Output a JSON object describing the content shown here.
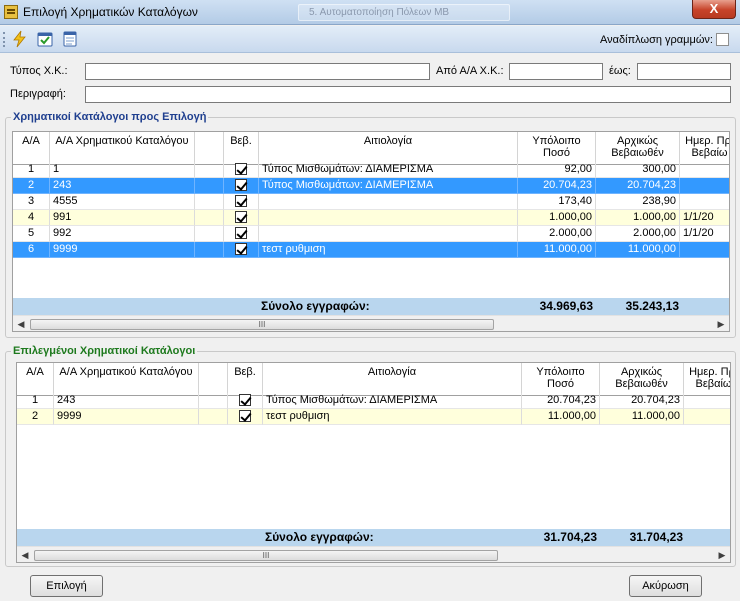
{
  "window": {
    "title": "Επιλογή Χρηματικών Καταλόγων",
    "background_tab": "5. Αυτοματοποίηση Πόλεων ΜΒ",
    "close_label": "X"
  },
  "toolbar": {
    "icons": [
      "lightning-icon",
      "check-calendar-icon",
      "calendar-icon"
    ],
    "wrap_lines_label": "Αναδίπλωση γραμμών:",
    "wrap_lines_checked": false
  },
  "filters": {
    "type_label": "Τύπος Χ.Κ.:",
    "type_value": "",
    "from_label": "Από Α/Α Χ.Κ.:",
    "from_value": "",
    "to_label": "έως:",
    "to_value": "",
    "description_label": "Περιγραφή:",
    "description_value": ""
  },
  "available": {
    "group_title": "Χρηματικοί Κατάλογοι προς Επιλογή",
    "columns": [
      "Α/Α",
      "Α/Α Χρηματικού Καταλόγου",
      "",
      "Βεβ.",
      "Αιτιολογία",
      "Υπόλοιπο Ποσό",
      "Αρχικώς Βεβαιωθέν",
      "Ημερ. Πρ. Βεβαίω"
    ],
    "rows": [
      {
        "aa": "1",
        "catalog": "1",
        "checked": true,
        "reason": "Τύπος Μισθωμάτων: ΔΙΑΜΕΡΙΣΜΑ",
        "balance": "92,00",
        "initial": "300,00",
        "date": "",
        "style": "normal"
      },
      {
        "aa": "2",
        "catalog": "243",
        "checked": true,
        "reason": "Τύπος Μισθωμάτων: ΔΙΑΜΕΡΙΣΜΑ",
        "balance": "20.704,23",
        "initial": "20.704,23",
        "date": "",
        "style": "selected"
      },
      {
        "aa": "3",
        "catalog": "4555",
        "checked": true,
        "reason": "",
        "balance": "173,40",
        "initial": "238,90",
        "date": "",
        "style": "normal"
      },
      {
        "aa": "4",
        "catalog": "991",
        "checked": true,
        "reason": "",
        "balance": "1.000,00",
        "initial": "1.000,00",
        "date": "1/1/20",
        "style": "alt"
      },
      {
        "aa": "5",
        "catalog": "992",
        "checked": true,
        "reason": "",
        "balance": "2.000,00",
        "initial": "2.000,00",
        "date": "1/1/20",
        "style": "normal"
      },
      {
        "aa": "6",
        "catalog": "9999",
        "checked": true,
        "reason": "τεστ ρυθμιση",
        "balance": "11.000,00",
        "initial": "11.000,00",
        "date": "",
        "style": "selected"
      }
    ],
    "total_label": "Σύνολο εγγραφών:",
    "total_balance": "34.969,63",
    "total_initial": "35.243,13",
    "scroll_thumb": "III"
  },
  "selected": {
    "group_title": "Επιλεγμένοι Χρηματικοί Κατάλογοι",
    "columns": [
      "Α/Α",
      "Α/Α Χρηματικού Καταλόγου",
      "",
      "Βεβ.",
      "Αιτιολογία",
      "Υπόλοιπο Ποσό",
      "Αρχικώς Βεβαιωθέν",
      "Ημερ. Πρ. Βεβαίω"
    ],
    "rows": [
      {
        "aa": "1",
        "catalog": "243",
        "checked": true,
        "reason": "Τύπος Μισθωμάτων: ΔΙΑΜΕΡΙΣΜΑ",
        "balance": "20.704,23",
        "initial": "20.704,23",
        "date": "",
        "style": "normal"
      },
      {
        "aa": "2",
        "catalog": "9999",
        "checked": true,
        "reason": "τεστ ρυθμιση",
        "balance": "11.000,00",
        "initial": "11.000,00",
        "date": "",
        "style": "alt"
      }
    ],
    "total_label": "Σύνολο εγγραφών:",
    "total_balance": "31.704,23",
    "total_initial": "31.704,23",
    "scroll_thumb": "III"
  },
  "buttons": {
    "select_label": "Επιλογή",
    "cancel_label": "Ακύρωση"
  },
  "colors": {
    "selection": "#3399ff",
    "alternate_row": "#ffffdc",
    "section1_title": "#1f3f8f",
    "section2_title": "#1e7a1e",
    "total_bar": "#b9d6ee"
  }
}
